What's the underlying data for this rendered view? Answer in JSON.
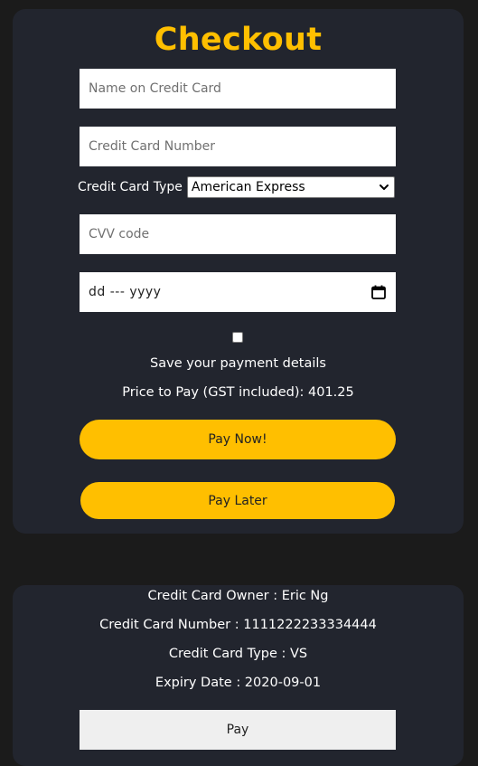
{
  "checkout": {
    "title": "Checkout",
    "name_placeholder": "Name on Credit Card",
    "number_placeholder": "Credit Card Number",
    "card_type_label": "Credit Card Type",
    "card_type_selected": "American Express",
    "cvv_placeholder": "CVV code",
    "expiry_display": "dd --- yyyy",
    "save_details_label": "Save your payment details",
    "save_details_checked": false,
    "price_text": "Price to Pay (GST included): 401.25",
    "pay_now_label": "Pay Now!",
    "pay_later_label": "Pay Later",
    "accent_color": "#ffbf00"
  },
  "saved_card": {
    "owner_text": "Credit Card Owner : Eric Ng",
    "number_text": "Credit Card Number : 1111222233334444",
    "type_text": "Credit Card Type : VS",
    "expiry_text": "Expiry Date : 2020-09-01",
    "pay_label": "Pay"
  },
  "icons": {
    "select_arrow": "chevron-down-icon",
    "date_picker": "calendar-icon"
  }
}
